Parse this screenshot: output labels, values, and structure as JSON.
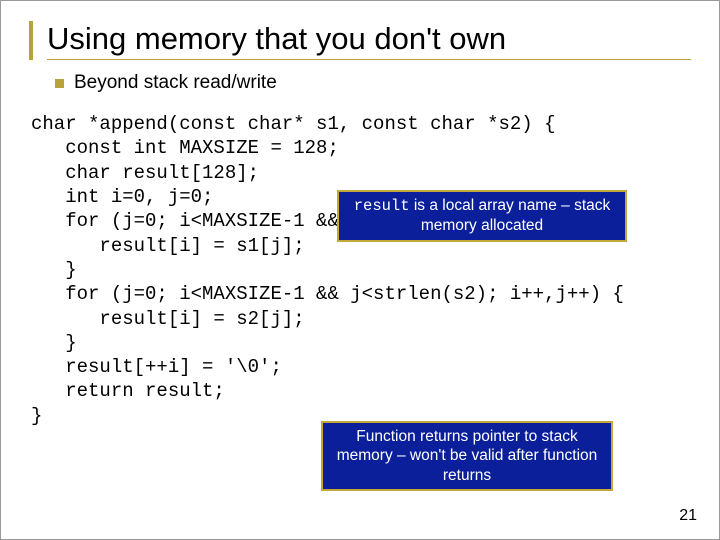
{
  "title": "Using memory that you don't own",
  "subtitle": "Beyond stack read/write",
  "code": "char *append(const char* s1, const char *s2) {\n   const int MAXSIZE = 128;\n   char result[128];\n   int i=0, j=0;\n   for (j=0; i<MAXSIZE-1 && j<strlen(s1); i++,j++) {\n      result[i] = s1[j];\n   }\n   for (j=0; i<MAXSIZE-1 && j<strlen(s2); i++,j++) {\n      result[i] = s2[j];\n   }\n   result[++i] = '\\0';\n   return result;\n}",
  "callout1": {
    "mono": "result",
    "rest": " is a local array name – stack memory allocated"
  },
  "callout2": "Function returns pointer to stack memory – won't be valid after function returns",
  "page": "21"
}
